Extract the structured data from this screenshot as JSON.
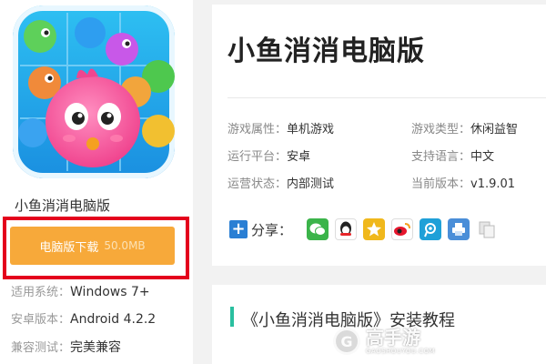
{
  "left_panel": {
    "app_name": "小鱼消消电脑版",
    "download": {
      "label": "电脑版下载",
      "size": "50.0MB"
    },
    "meta": [
      {
        "key": "适用系统：",
        "value": "Windows 7+"
      },
      {
        "key": "安卓版本：",
        "value": "Android 4.2.2"
      },
      {
        "key": "兼容测试：",
        "value": "完美兼容"
      }
    ]
  },
  "header": {
    "title": "小鱼消消电脑版"
  },
  "attributes": [
    {
      "key": "游戏属性：",
      "value": "单机游戏"
    },
    {
      "key": "游戏类型：",
      "value": "休闲益智"
    },
    {
      "key": "运行平台：",
      "value": "安卓"
    },
    {
      "key": "支持语言：",
      "value": "中文"
    },
    {
      "key": "运营状态：",
      "value": "内部测试"
    },
    {
      "key": "当前版本：",
      "value": "v1.9.01"
    }
  ],
  "share": {
    "label": "分享：",
    "icons": [
      {
        "name": "wechat-icon",
        "color": "#3bb44a"
      },
      {
        "name": "qq-icon",
        "color": "#2a9be0"
      },
      {
        "name": "qzone-icon",
        "color": "#f0b81c"
      },
      {
        "name": "weibo-icon",
        "color": "#e6162d"
      },
      {
        "name": "tencent-weibo-icon",
        "color": "#1fa0d8"
      },
      {
        "name": "print-icon",
        "color": "#4a8ed8"
      },
      {
        "name": "copy-icon",
        "color": "#c8c8c8"
      }
    ]
  },
  "tutorial": {
    "title": "《小鱼消消电脑版》安装教程"
  },
  "watermark": {
    "brand": "高手游",
    "domain": "GAOSHOUYOU.COM"
  },
  "colors": {
    "download": "#f7a93a",
    "highlight_frame": "#e4001c",
    "tutorial_bar": "#2abf9f"
  }
}
